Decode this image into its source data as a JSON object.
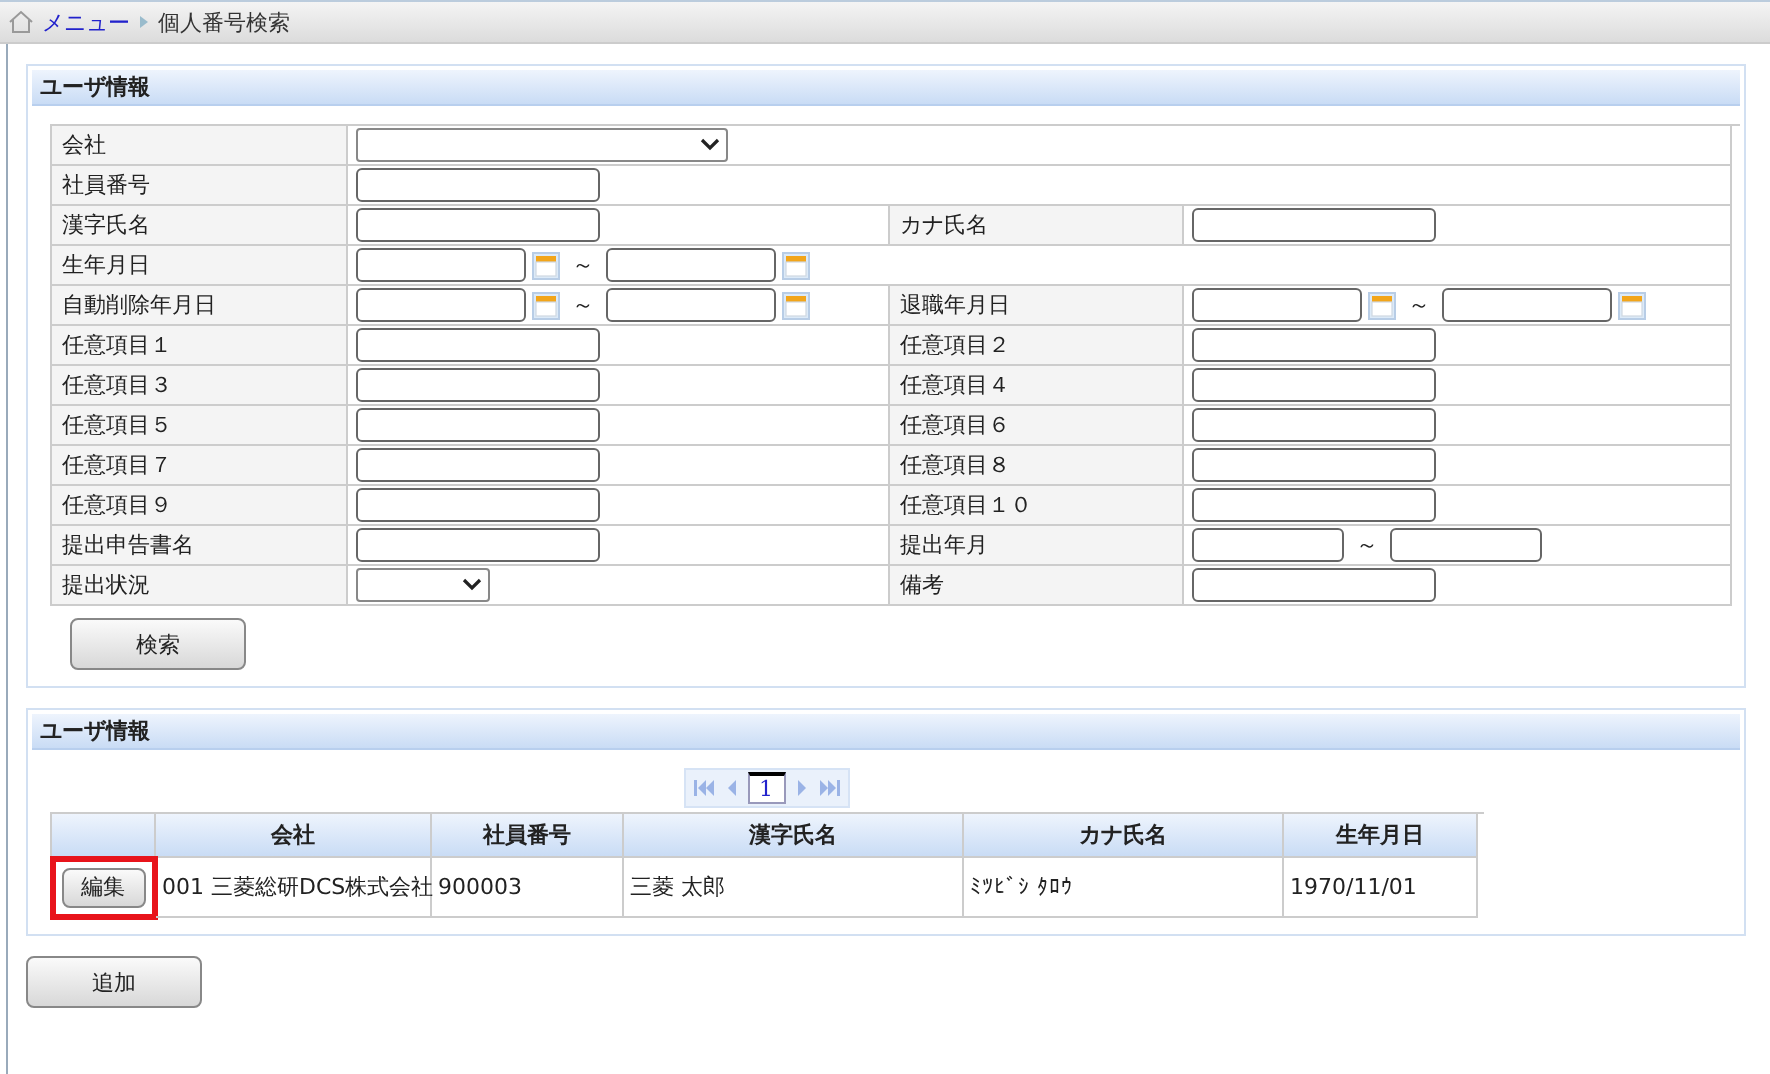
{
  "breadcrumb": {
    "home_link": "メニュー",
    "current": "個人番号検索"
  },
  "search_panel": {
    "title": "ユーザ情報",
    "rows": [
      {
        "fields": [
          {
            "label": "会社",
            "kind": "select_wide"
          }
        ]
      },
      {
        "fields": [
          {
            "label": "社員番号",
            "kind": "text"
          }
        ]
      },
      {
        "fields": [
          {
            "label": "漢字氏名",
            "kind": "text"
          },
          {
            "label": "カナ氏名",
            "kind": "text"
          }
        ]
      },
      {
        "fields": [
          {
            "label": "生年月日",
            "kind": "date_range",
            "separator": "～"
          }
        ]
      },
      {
        "fields": [
          {
            "label": "自動削除年月日",
            "kind": "date_range",
            "separator": "～"
          },
          {
            "label": "退職年月日",
            "kind": "date_range",
            "separator": "～"
          }
        ]
      },
      {
        "fields": [
          {
            "label": "任意項目１",
            "kind": "text"
          },
          {
            "label": "任意項目２",
            "kind": "text"
          }
        ]
      },
      {
        "fields": [
          {
            "label": "任意項目３",
            "kind": "text"
          },
          {
            "label": "任意項目４",
            "kind": "text"
          }
        ]
      },
      {
        "fields": [
          {
            "label": "任意項目５",
            "kind": "text"
          },
          {
            "label": "任意項目６",
            "kind": "text"
          }
        ]
      },
      {
        "fields": [
          {
            "label": "任意項目７",
            "kind": "text"
          },
          {
            "label": "任意項目８",
            "kind": "text"
          }
        ]
      },
      {
        "fields": [
          {
            "label": "任意項目９",
            "kind": "text"
          },
          {
            "label": "任意項目１０",
            "kind": "text"
          }
        ]
      },
      {
        "fields": [
          {
            "label": "提出申告書名",
            "kind": "text"
          },
          {
            "label": "提出年月",
            "kind": "month_range",
            "separator": "～"
          }
        ]
      },
      {
        "fields": [
          {
            "label": "提出状況",
            "kind": "select_small"
          },
          {
            "label": "備考",
            "kind": "text"
          }
        ]
      }
    ],
    "search_button": "検索"
  },
  "results_panel": {
    "title": "ユーザ情報",
    "pager": {
      "page": "1"
    },
    "columns": [
      "会社",
      "社員番号",
      "漢字氏名",
      "カナ氏名",
      "生年月日"
    ],
    "rows": [
      {
        "edit_button": "編集",
        "highlighted": true,
        "cells": [
          "001 三菱総研DCS株式会社",
          "900003",
          "三菱 太郎",
          "ﾐﾂﾋﾞｼ ﾀﾛｳ",
          "1970/11/01"
        ]
      }
    ]
  },
  "add_button": "追加"
}
